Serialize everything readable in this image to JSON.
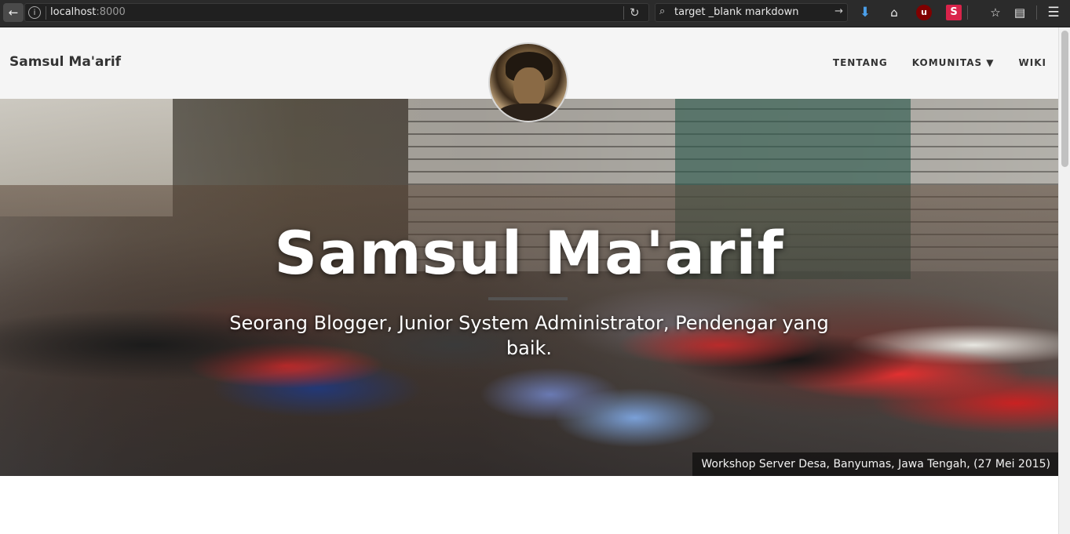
{
  "browser": {
    "url_host": "localhost",
    "url_port": ":8000",
    "search_query": "target _blank markdown",
    "icons": {
      "back": "back-arrow-icon",
      "info": "info-icon",
      "reload": "reload-icon",
      "search": "search-icon",
      "download": "download-icon",
      "home": "home-icon",
      "ublock": "ublock-icon",
      "stylish": "stylish-icon",
      "bookmark": "star-icon",
      "clipboard": "clipboard-icon",
      "menu": "hamburger-menu-icon"
    },
    "ublock_label": "u",
    "stylish_label": "S"
  },
  "navbar": {
    "brand": "Samsul Ma'arif",
    "items": [
      {
        "label": "TENTANG"
      },
      {
        "label": "KOMUNITAS ▼"
      },
      {
        "label": "WIKI"
      }
    ]
  },
  "hero": {
    "title": "Samsul Ma'arif",
    "subtitle": "Seorang Blogger, Junior System Administrator, Pendengar yang baik.",
    "caption": "Workshop Server Desa, Banyumas, Jawa Tengah, (27 Mei 2015)"
  }
}
